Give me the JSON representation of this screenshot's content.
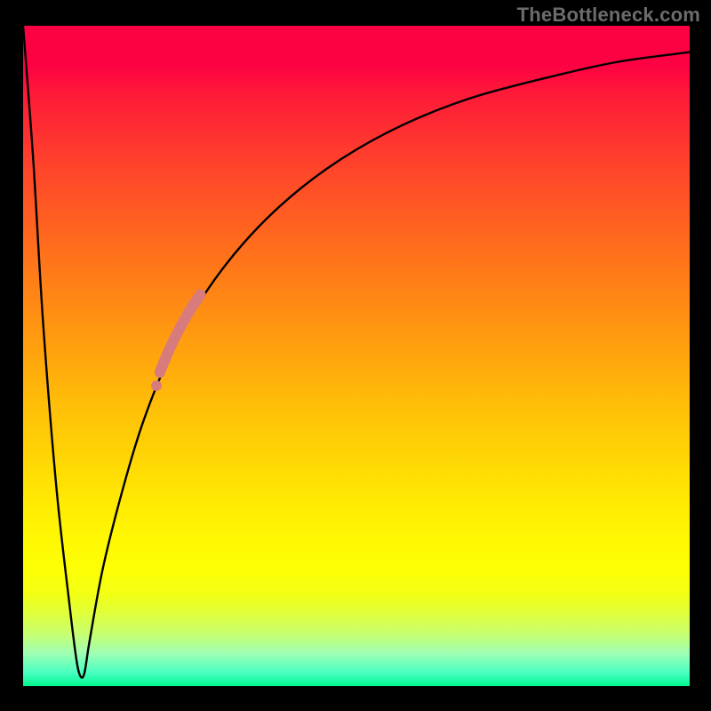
{
  "watermark": "TheBottleneck.com",
  "chart_data": {
    "type": "line",
    "title": "",
    "xlabel": "",
    "ylabel": "",
    "xlim": [
      0,
      100
    ],
    "ylim": [
      0,
      100
    ],
    "grid": false,
    "series": [
      {
        "name": "bottleneck-curve",
        "color": "#000000",
        "x": [
          0,
          1.5,
          3,
          5,
          7,
          8,
          8.6,
          9.2,
          10,
          12,
          15,
          18,
          22,
          27,
          33,
          40,
          48,
          57,
          67,
          78,
          89,
          100
        ],
        "y": [
          100,
          80,
          55,
          30,
          12,
          4,
          1.5,
          2,
          7,
          18,
          30,
          40,
          50,
          59,
          67,
          74,
          80,
          85,
          89,
          92,
          94.5,
          96
        ]
      }
    ],
    "highlight": {
      "name": "highlight-segment",
      "color": "#d87b7c",
      "points": [
        {
          "x": 20.5,
          "y": 47.5
        },
        {
          "x": 21.5,
          "y": 50.0
        },
        {
          "x": 22.5,
          "y": 52.2
        },
        {
          "x": 23.5,
          "y": 54.2
        },
        {
          "x": 24.5,
          "y": 56.0
        },
        {
          "x": 25.5,
          "y": 57.7
        },
        {
          "x": 26.6,
          "y": 59.3
        }
      ],
      "gap_point": {
        "x": 20.0,
        "y": 45.5
      }
    },
    "gradient_stops": [
      {
        "pct": 0,
        "color": "#fd0243"
      },
      {
        "pct": 22,
        "color": "#ff462a"
      },
      {
        "pct": 46,
        "color": "#ff9710"
      },
      {
        "pct": 68,
        "color": "#ffde04"
      },
      {
        "pct": 86,
        "color": "#f3ff14"
      },
      {
        "pct": 100,
        "color": "#00f88e"
      }
    ]
  }
}
